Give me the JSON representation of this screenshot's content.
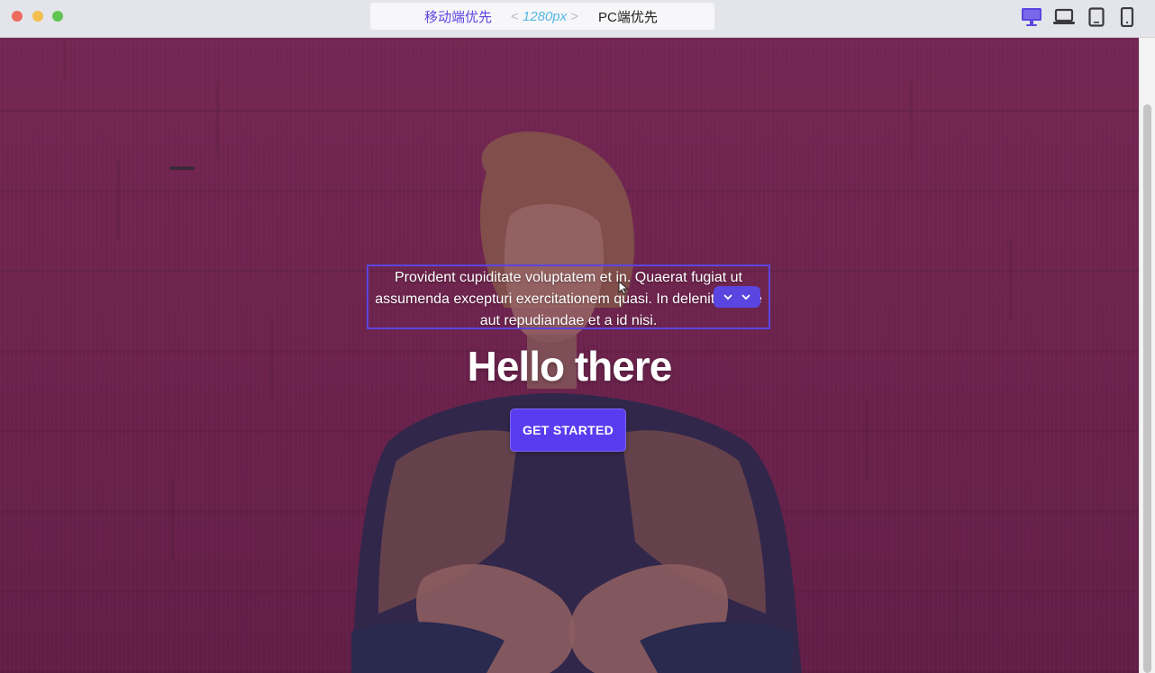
{
  "toolbar": {
    "mode_left": "移动端优先",
    "mode_width_prefix": "<",
    "mode_width_value": "1280px",
    "mode_width_suffix": ">",
    "mode_right": "PC端优先",
    "devices": [
      "desktop-icon",
      "laptop-icon",
      "tablet-icon",
      "mobile-icon"
    ],
    "active_device": "desktop-icon"
  },
  "hero": {
    "paragraph": "Provident cupiditate voluptatem et in. Quaerat fugiat ut assumenda excepturi exercitationem quasi. In deleniti eaque aut repudiandae et a id nisi.",
    "title": "Hello there",
    "cta_label": "GET STARTED"
  },
  "colors": {
    "accent": "#5a3cf0",
    "hero_bg": "#7b2a55"
  }
}
